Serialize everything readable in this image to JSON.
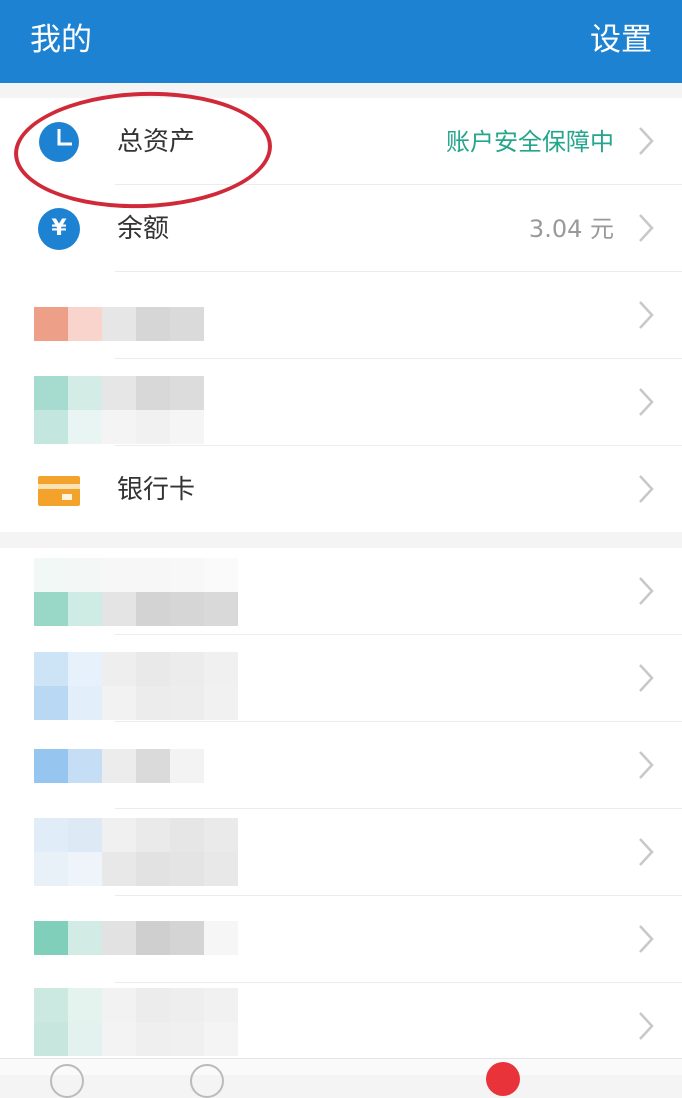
{
  "header": {
    "title": "我的",
    "settings": "设置"
  },
  "assets": {
    "label": "总资产",
    "status": "账户安全保障中"
  },
  "balance": {
    "label": "余额",
    "value": "3.04 元"
  },
  "bank_card": {
    "label": "银行卡"
  },
  "colors": {
    "brand_blue": "#1e82d2",
    "safe_teal": "#24a58c",
    "highlight_red": "#d02a3a",
    "card_orange": "#f3a22c"
  },
  "icons": [
    "pie-chart-icon",
    "yen-icon",
    "bank-card-icon",
    "chevron-right-icon"
  ]
}
